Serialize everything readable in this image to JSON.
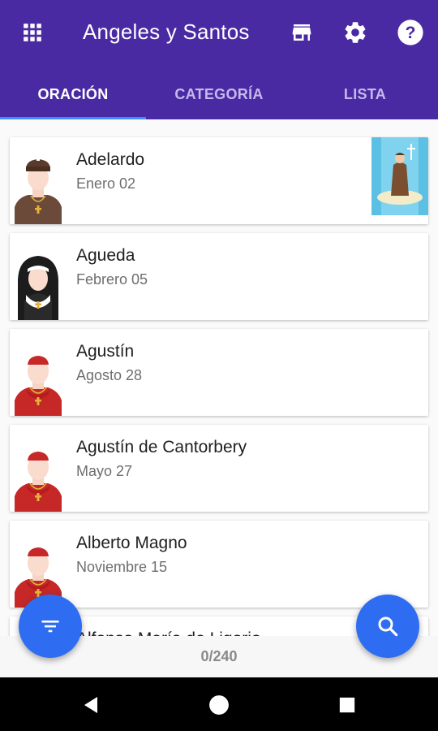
{
  "app": {
    "title": "Angeles y Santos",
    "accent_color": "#4a2aa3",
    "fab_color": "#2e6df2",
    "toolbar_icons": [
      "apps-grid-icon",
      "store-icon",
      "settings-gear-icon",
      "help-circle-icon"
    ]
  },
  "tabs": [
    {
      "label": "ORACIÓN",
      "active": true
    },
    {
      "label": "CATEGORÍA",
      "active": false
    },
    {
      "label": "LISTA",
      "active": false
    }
  ],
  "saints": [
    {
      "name": "Adelardo",
      "date": "Enero 02",
      "avatar": "monk-brown-avatar",
      "has_thumbnail": true
    },
    {
      "name": "Agueda",
      "date": "Febrero 05",
      "avatar": "nun-avatar"
    },
    {
      "name": "Agustín",
      "date": "Agosto 28",
      "avatar": "bishop-red-avatar"
    },
    {
      "name": "Agustín de Cantorbery",
      "date": "Mayo 27",
      "avatar": "bishop-red-avatar"
    },
    {
      "name": "Alberto Magno",
      "date": "Noviembre 15",
      "avatar": "bishop-red-avatar"
    },
    {
      "name": "Alfonso María de Ligorio",
      "date": "",
      "avatar": "bishop-red-avatar"
    }
  ],
  "footer": {
    "counter": "0/240"
  },
  "fabs": {
    "filter_icon": "filter-icon",
    "search_icon": "search-icon"
  },
  "system_nav": [
    "back-icon",
    "home-icon",
    "recents-icon"
  ]
}
